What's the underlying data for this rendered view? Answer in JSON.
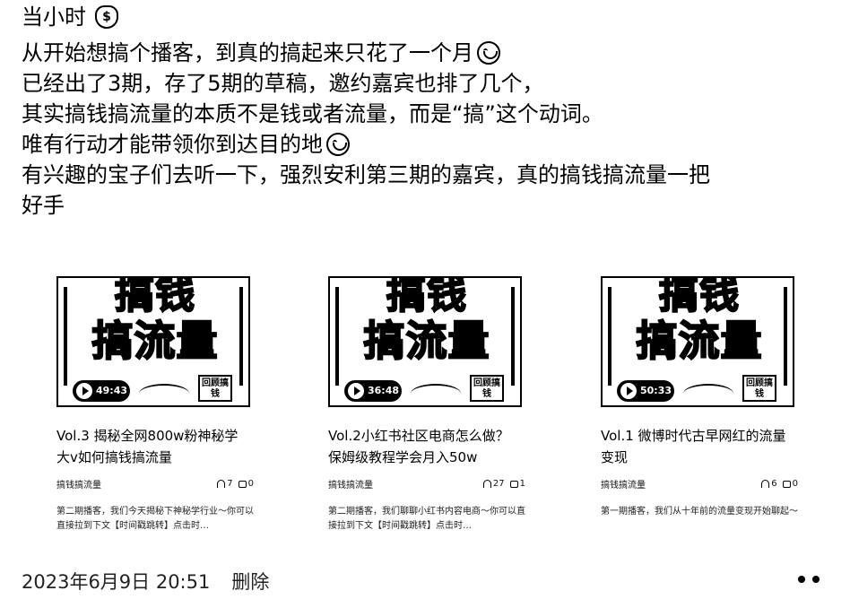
{
  "header": {
    "title": "当小时",
    "icon": "money-bag-icon"
  },
  "post": {
    "lines": [
      "从开始想搞个播客，到真的搞起来只花了一个月",
      "已经出了3期，存了5期的草稿，邀约嘉宾也排了几个，",
      "其实搞钱搞流量的本质不是钱或者流量，而是“搞”这个动词。",
      "唯有行动才能带领你到达目的地",
      "有兴趣的宝子们去听一下，强烈安利第三期的嘉宾，真的搞钱搞流量一把",
      "好手"
    ]
  },
  "cards": [
    {
      "cover_line1": "搞钱",
      "cover_line2": "搞流量",
      "duration": "49:43",
      "stamp": "回顾搞钱",
      "title": "Vol.3 揭秘全网800w粉神秘学大v如何搞钱搞流量",
      "channel": "搞钱搞流量",
      "listeners": "7",
      "comments": "0",
      "desc": "第二期播客，我们今天揭秘下神秘学行业～你可以直接拉到下文【时间戳跳转】点击时…"
    },
    {
      "cover_line1": "搞钱",
      "cover_line2": "搞流量",
      "duration": "36:48",
      "stamp": "回顾搞钱",
      "title": "Vol.2小红书社区电商怎么做？保姆级教程学会月入50w",
      "channel": "搞钱搞流量",
      "listeners": "27",
      "comments": "1",
      "desc": "第二期播客，我们聊聊小红书内容电商～你可以直接拉到下文【时间戳跳转】点击时…"
    },
    {
      "cover_line1": "搞钱",
      "cover_line2": "搞流量",
      "duration": "50:33",
      "stamp": "回顾搞钱",
      "title": "Vol.1 微博时代古早网红的流量变现",
      "channel": "搞钱搞流量",
      "listeners": "6",
      "comments": "0",
      "desc": "第一期播客，我们从十年前的流量变现开始聊起～"
    }
  ],
  "footer": {
    "timestamp": "2023年6月9日 20:51",
    "delete_label": "删除"
  }
}
